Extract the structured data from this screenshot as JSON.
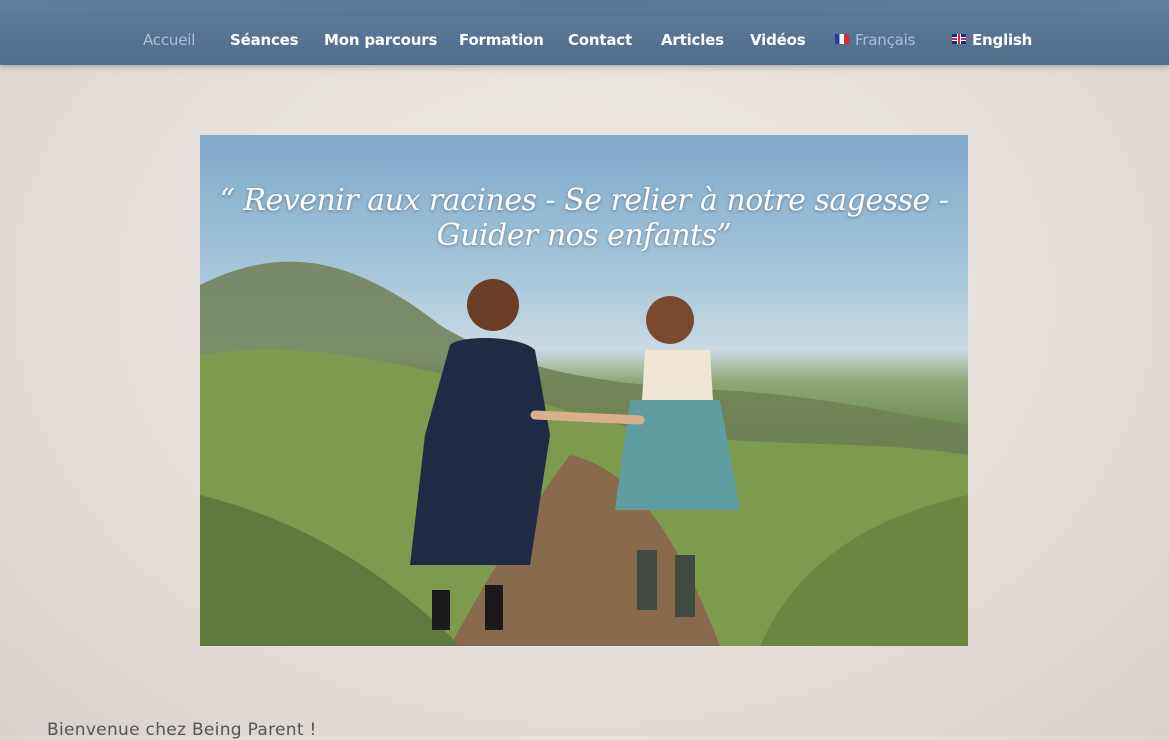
{
  "nav": {
    "items": [
      {
        "label": "Accueil",
        "active": true
      },
      {
        "label": "Séances"
      },
      {
        "label": "Mon parcours"
      },
      {
        "label": "Formation"
      },
      {
        "label": "Contact"
      },
      {
        "label": "Articles"
      },
      {
        "label": "Vidéos"
      }
    ],
    "languages": [
      {
        "label": "Français",
        "flag": "flag-fr-icon",
        "active": true
      },
      {
        "label": "English",
        "flag": "flag-en-icon"
      }
    ]
  },
  "hero": {
    "quote": "“ Revenir aux racines - Se relier à notre sagesse - Guider nos enfants”"
  },
  "main": {
    "welcome": "Bienvenue chez Being Parent !"
  },
  "colors": {
    "nav_bg": "#54728f",
    "nav_active": "#a9c0d8",
    "page_bg": "#e7e0da"
  }
}
